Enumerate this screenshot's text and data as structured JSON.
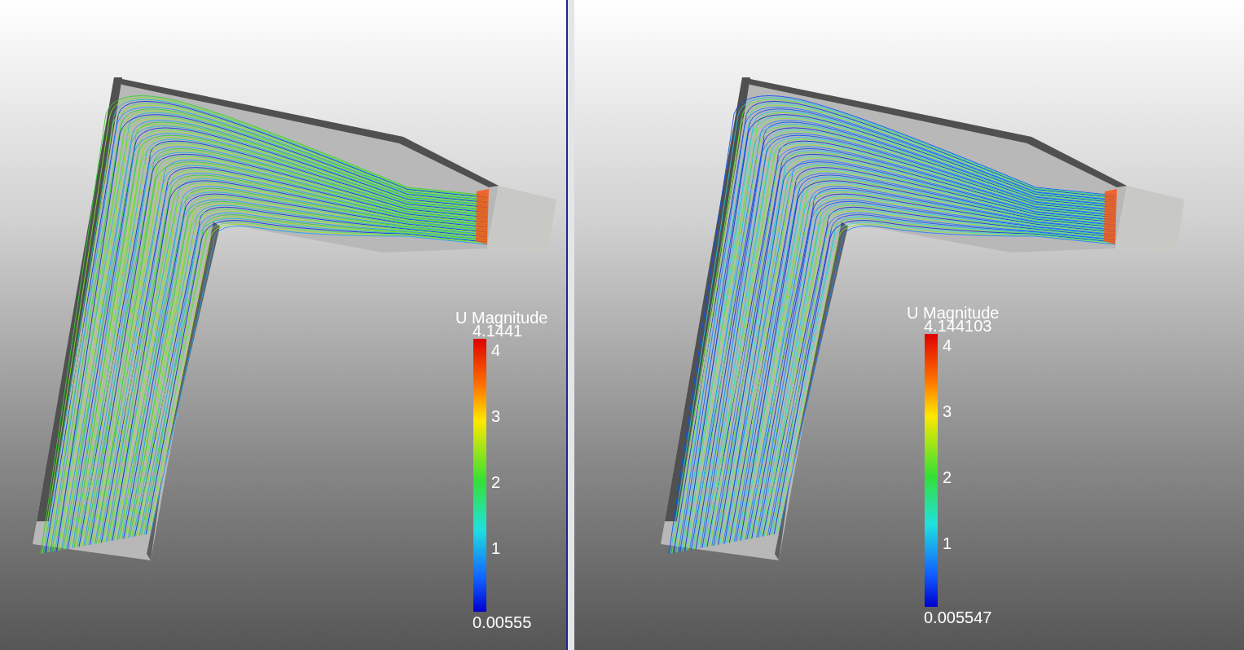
{
  "views": [
    {
      "legend": {
        "title": "U Magnitude",
        "max": "4.1441",
        "ticks": [
          "4",
          "3",
          "2",
          "1"
        ],
        "min": "0.00555"
      }
    },
    {
      "legend": {
        "title": "U Magnitude",
        "max": "4.144103",
        "ticks": [
          "4",
          "3",
          "2",
          "1"
        ],
        "min": "0.005547"
      }
    }
  ]
}
